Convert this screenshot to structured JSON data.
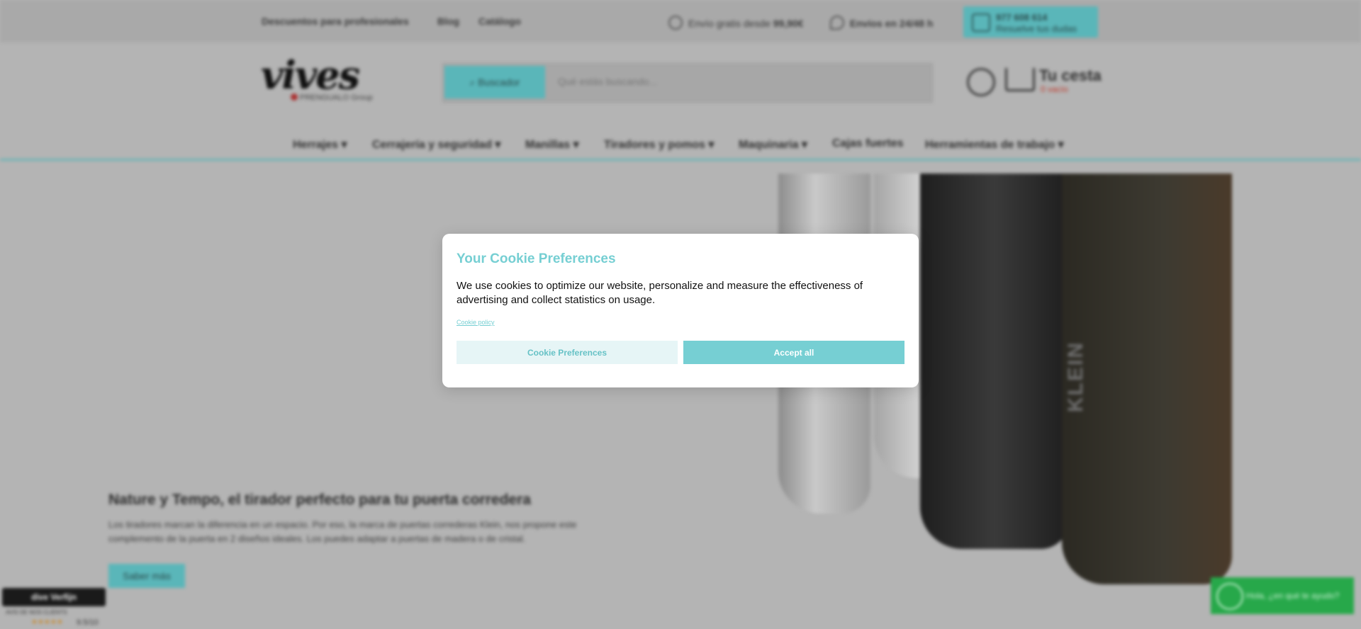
{
  "topbar": {
    "links": [
      "Descuentos para profesionales",
      "Blog",
      "Catálogo"
    ],
    "shipping_free_prefix": "Envío gratis desde",
    "shipping_free_amount": "99,90€",
    "shipping_time": "Envíos en 24/48 h",
    "phone_number": "977 608 614",
    "phone_cta": "Resuelve tus dudas"
  },
  "header": {
    "logo_text": "vives",
    "logo_group": "PRENGUALO Group",
    "search_button": "Buscador",
    "search_placeholder": "Qué estás buscando...",
    "cart_title": "Tu cesta",
    "cart_status": "0 vacío"
  },
  "nav": {
    "items": [
      {
        "label": "Herrajes",
        "has_dropdown": true
      },
      {
        "label": "Cerrajería y seguridad",
        "has_dropdown": true
      },
      {
        "label": "Manillas",
        "has_dropdown": true
      },
      {
        "label": "Tiradores y pomos",
        "has_dropdown": true
      },
      {
        "label": "Maquinaria",
        "has_dropdown": true
      },
      {
        "label": "Cajas fuertes",
        "has_dropdown": false
      },
      {
        "label": "Herramientas de trabajo",
        "has_dropdown": true
      }
    ]
  },
  "hero": {
    "title": "Nature y Tempo, el tirador perfecto para tu puerta corredera",
    "text": "Los tiradores marcan la diferencia en un espacio. Por eso, la marca de puertas correderas Klein, nos propone este complemento de la puerta en 2 diseños ideales. Los puedes adaptar a puertas de madera o de cristal.",
    "button": "Saber más",
    "product_brand": "KLEIN"
  },
  "trust_badge": {
    "brand": "dive Verfijn",
    "subtitle": "AVIS DE NOS CLIENTS",
    "stars": "★★★★★",
    "score": "9.5/10"
  },
  "whatsapp": {
    "text": "Hola, ¿en qué te ayudo?"
  },
  "cookie_modal": {
    "title": "Your Cookie Preferences",
    "text": "We use cookies to optimize our website, personalize and measure the effectiveness of advertising and collect statistics on usage.",
    "policy_link": "Cookie policy",
    "preferences_button": "Cookie Preferences",
    "accept_button": "Accept all"
  },
  "colors": {
    "accent": "#76cfd3",
    "accent_light": "#e6f5f6",
    "whatsapp": "#27a84a",
    "cart_status": "#c0392b"
  }
}
